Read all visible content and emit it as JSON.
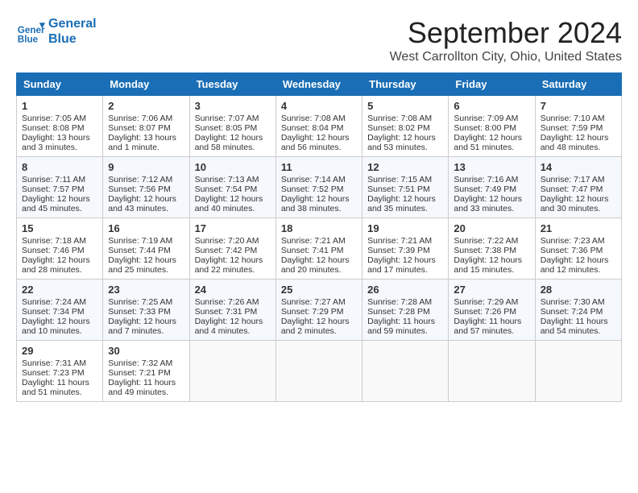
{
  "header": {
    "logo_line1": "General",
    "logo_line2": "Blue",
    "month_title": "September 2024",
    "location": "West Carrollton City, Ohio, United States"
  },
  "days_of_week": [
    "Sunday",
    "Monday",
    "Tuesday",
    "Wednesday",
    "Thursday",
    "Friday",
    "Saturday"
  ],
  "weeks": [
    [
      {
        "day": 1,
        "lines": [
          "Sunrise: 7:05 AM",
          "Sunset: 8:08 PM",
          "Daylight: 13 hours",
          "and 3 minutes."
        ]
      },
      {
        "day": 2,
        "lines": [
          "Sunrise: 7:06 AM",
          "Sunset: 8:07 PM",
          "Daylight: 13 hours",
          "and 1 minute."
        ]
      },
      {
        "day": 3,
        "lines": [
          "Sunrise: 7:07 AM",
          "Sunset: 8:05 PM",
          "Daylight: 12 hours",
          "and 58 minutes."
        ]
      },
      {
        "day": 4,
        "lines": [
          "Sunrise: 7:08 AM",
          "Sunset: 8:04 PM",
          "Daylight: 12 hours",
          "and 56 minutes."
        ]
      },
      {
        "day": 5,
        "lines": [
          "Sunrise: 7:08 AM",
          "Sunset: 8:02 PM",
          "Daylight: 12 hours",
          "and 53 minutes."
        ]
      },
      {
        "day": 6,
        "lines": [
          "Sunrise: 7:09 AM",
          "Sunset: 8:00 PM",
          "Daylight: 12 hours",
          "and 51 minutes."
        ]
      },
      {
        "day": 7,
        "lines": [
          "Sunrise: 7:10 AM",
          "Sunset: 7:59 PM",
          "Daylight: 12 hours",
          "and 48 minutes."
        ]
      }
    ],
    [
      {
        "day": 8,
        "lines": [
          "Sunrise: 7:11 AM",
          "Sunset: 7:57 PM",
          "Daylight: 12 hours",
          "and 45 minutes."
        ]
      },
      {
        "day": 9,
        "lines": [
          "Sunrise: 7:12 AM",
          "Sunset: 7:56 PM",
          "Daylight: 12 hours",
          "and 43 minutes."
        ]
      },
      {
        "day": 10,
        "lines": [
          "Sunrise: 7:13 AM",
          "Sunset: 7:54 PM",
          "Daylight: 12 hours",
          "and 40 minutes."
        ]
      },
      {
        "day": 11,
        "lines": [
          "Sunrise: 7:14 AM",
          "Sunset: 7:52 PM",
          "Daylight: 12 hours",
          "and 38 minutes."
        ]
      },
      {
        "day": 12,
        "lines": [
          "Sunrise: 7:15 AM",
          "Sunset: 7:51 PM",
          "Daylight: 12 hours",
          "and 35 minutes."
        ]
      },
      {
        "day": 13,
        "lines": [
          "Sunrise: 7:16 AM",
          "Sunset: 7:49 PM",
          "Daylight: 12 hours",
          "and 33 minutes."
        ]
      },
      {
        "day": 14,
        "lines": [
          "Sunrise: 7:17 AM",
          "Sunset: 7:47 PM",
          "Daylight: 12 hours",
          "and 30 minutes."
        ]
      }
    ],
    [
      {
        "day": 15,
        "lines": [
          "Sunrise: 7:18 AM",
          "Sunset: 7:46 PM",
          "Daylight: 12 hours",
          "and 28 minutes."
        ]
      },
      {
        "day": 16,
        "lines": [
          "Sunrise: 7:19 AM",
          "Sunset: 7:44 PM",
          "Daylight: 12 hours",
          "and 25 minutes."
        ]
      },
      {
        "day": 17,
        "lines": [
          "Sunrise: 7:20 AM",
          "Sunset: 7:42 PM",
          "Daylight: 12 hours",
          "and 22 minutes."
        ]
      },
      {
        "day": 18,
        "lines": [
          "Sunrise: 7:21 AM",
          "Sunset: 7:41 PM",
          "Daylight: 12 hours",
          "and 20 minutes."
        ]
      },
      {
        "day": 19,
        "lines": [
          "Sunrise: 7:21 AM",
          "Sunset: 7:39 PM",
          "Daylight: 12 hours",
          "and 17 minutes."
        ]
      },
      {
        "day": 20,
        "lines": [
          "Sunrise: 7:22 AM",
          "Sunset: 7:38 PM",
          "Daylight: 12 hours",
          "and 15 minutes."
        ]
      },
      {
        "day": 21,
        "lines": [
          "Sunrise: 7:23 AM",
          "Sunset: 7:36 PM",
          "Daylight: 12 hours",
          "and 12 minutes."
        ]
      }
    ],
    [
      {
        "day": 22,
        "lines": [
          "Sunrise: 7:24 AM",
          "Sunset: 7:34 PM",
          "Daylight: 12 hours",
          "and 10 minutes."
        ]
      },
      {
        "day": 23,
        "lines": [
          "Sunrise: 7:25 AM",
          "Sunset: 7:33 PM",
          "Daylight: 12 hours",
          "and 7 minutes."
        ]
      },
      {
        "day": 24,
        "lines": [
          "Sunrise: 7:26 AM",
          "Sunset: 7:31 PM",
          "Daylight: 12 hours",
          "and 4 minutes."
        ]
      },
      {
        "day": 25,
        "lines": [
          "Sunrise: 7:27 AM",
          "Sunset: 7:29 PM",
          "Daylight: 12 hours",
          "and 2 minutes."
        ]
      },
      {
        "day": 26,
        "lines": [
          "Sunrise: 7:28 AM",
          "Sunset: 7:28 PM",
          "Daylight: 11 hours",
          "and 59 minutes."
        ]
      },
      {
        "day": 27,
        "lines": [
          "Sunrise: 7:29 AM",
          "Sunset: 7:26 PM",
          "Daylight: 11 hours",
          "and 57 minutes."
        ]
      },
      {
        "day": 28,
        "lines": [
          "Sunrise: 7:30 AM",
          "Sunset: 7:24 PM",
          "Daylight: 11 hours",
          "and 54 minutes."
        ]
      }
    ],
    [
      {
        "day": 29,
        "lines": [
          "Sunrise: 7:31 AM",
          "Sunset: 7:23 PM",
          "Daylight: 11 hours",
          "and 51 minutes."
        ]
      },
      {
        "day": 30,
        "lines": [
          "Sunrise: 7:32 AM",
          "Sunset: 7:21 PM",
          "Daylight: 11 hours",
          "and 49 minutes."
        ]
      },
      null,
      null,
      null,
      null,
      null
    ]
  ]
}
